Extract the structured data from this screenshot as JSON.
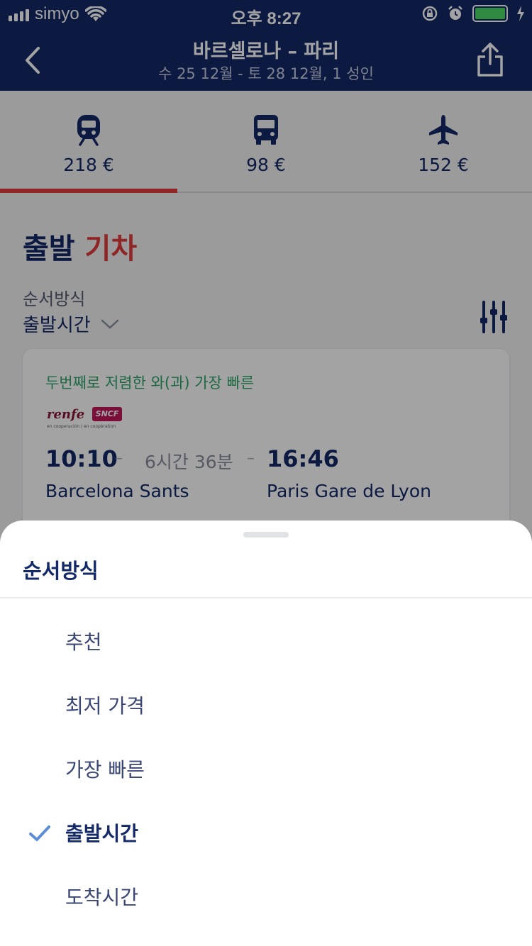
{
  "status_bar": {
    "carrier": "simyo",
    "time": "오후 8:27"
  },
  "header": {
    "title": "바르셀로나 – 파리",
    "subtitle": "수 25 12월 - 토 28 12월, 1 성인"
  },
  "transport_tabs": [
    {
      "icon": "train-icon",
      "price": "218 €",
      "selected": true
    },
    {
      "icon": "bus-icon",
      "price": "98 €",
      "selected": false
    },
    {
      "icon": "plane-icon",
      "price": "152 €",
      "selected": false
    }
  ],
  "section": {
    "title_main": "출발",
    "title_accent": "기차"
  },
  "sort": {
    "label": "순서방식",
    "value": "출발시간"
  },
  "result_card": {
    "badge": "두번째로 저렴한 와(과) 가장 빠른",
    "logo_renfe": "renfe",
    "logo_sncf": "SNCF",
    "logo_coop": "en cooperación / en coopération",
    "departure_time": "10:10",
    "duration": "6시간 36분",
    "arrival_time": "16:46",
    "departure_station": "Barcelona Sants",
    "arrival_station": "Paris Gare de Lyon"
  },
  "sort_sheet": {
    "title": "순서방식",
    "options": [
      {
        "label": "추천",
        "selected": false
      },
      {
        "label": "최저 가격",
        "selected": false
      },
      {
        "label": "가장 빠른",
        "selected": false
      },
      {
        "label": "출발시간",
        "selected": true
      },
      {
        "label": "도착시간",
        "selected": false
      }
    ]
  },
  "colors": {
    "brand_navy": "#132968",
    "accent_red": "#e03b3b",
    "badge_green": "#2ea36a",
    "check_blue": "#5b8ed6"
  }
}
